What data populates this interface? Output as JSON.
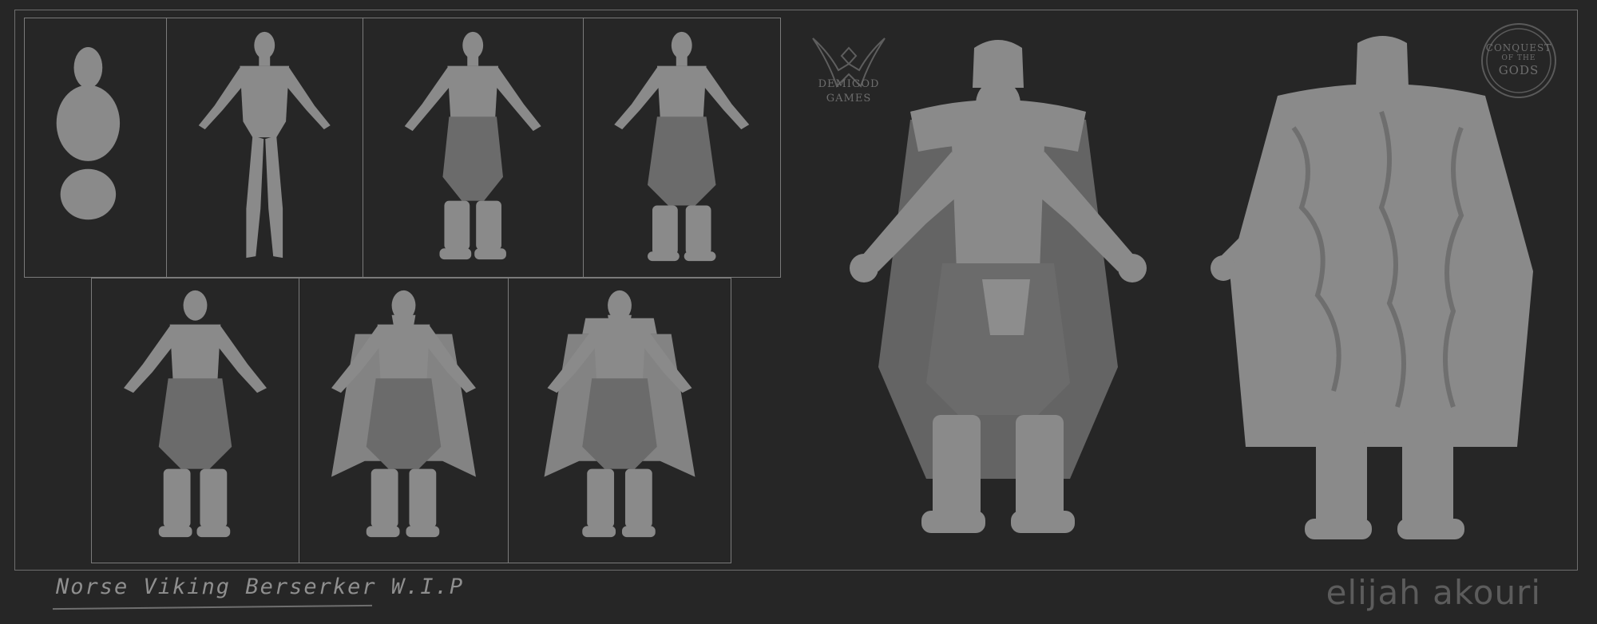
{
  "artwork": {
    "caption": "Norse Viking Berserker W.I.P",
    "author": "elijah akouri",
    "logo_left": {
      "line1": "DEMIGOD",
      "line2": "GAMES"
    },
    "logo_right": {
      "line1": "CONQUEST",
      "line2": "OF THE",
      "line3": "GODS"
    }
  },
  "colors": {
    "background": "#262626",
    "sculpt_clay": "#8a8a8a",
    "frame_lines": "#7a7a7a"
  },
  "stages": [
    "blockout-stage",
    "base-body-stage",
    "pants-boots-stage",
    "cloth-arm-wraps-stage",
    "hair-straps-stage",
    "beard-cape-stage",
    "fur-mantle-stage"
  ]
}
